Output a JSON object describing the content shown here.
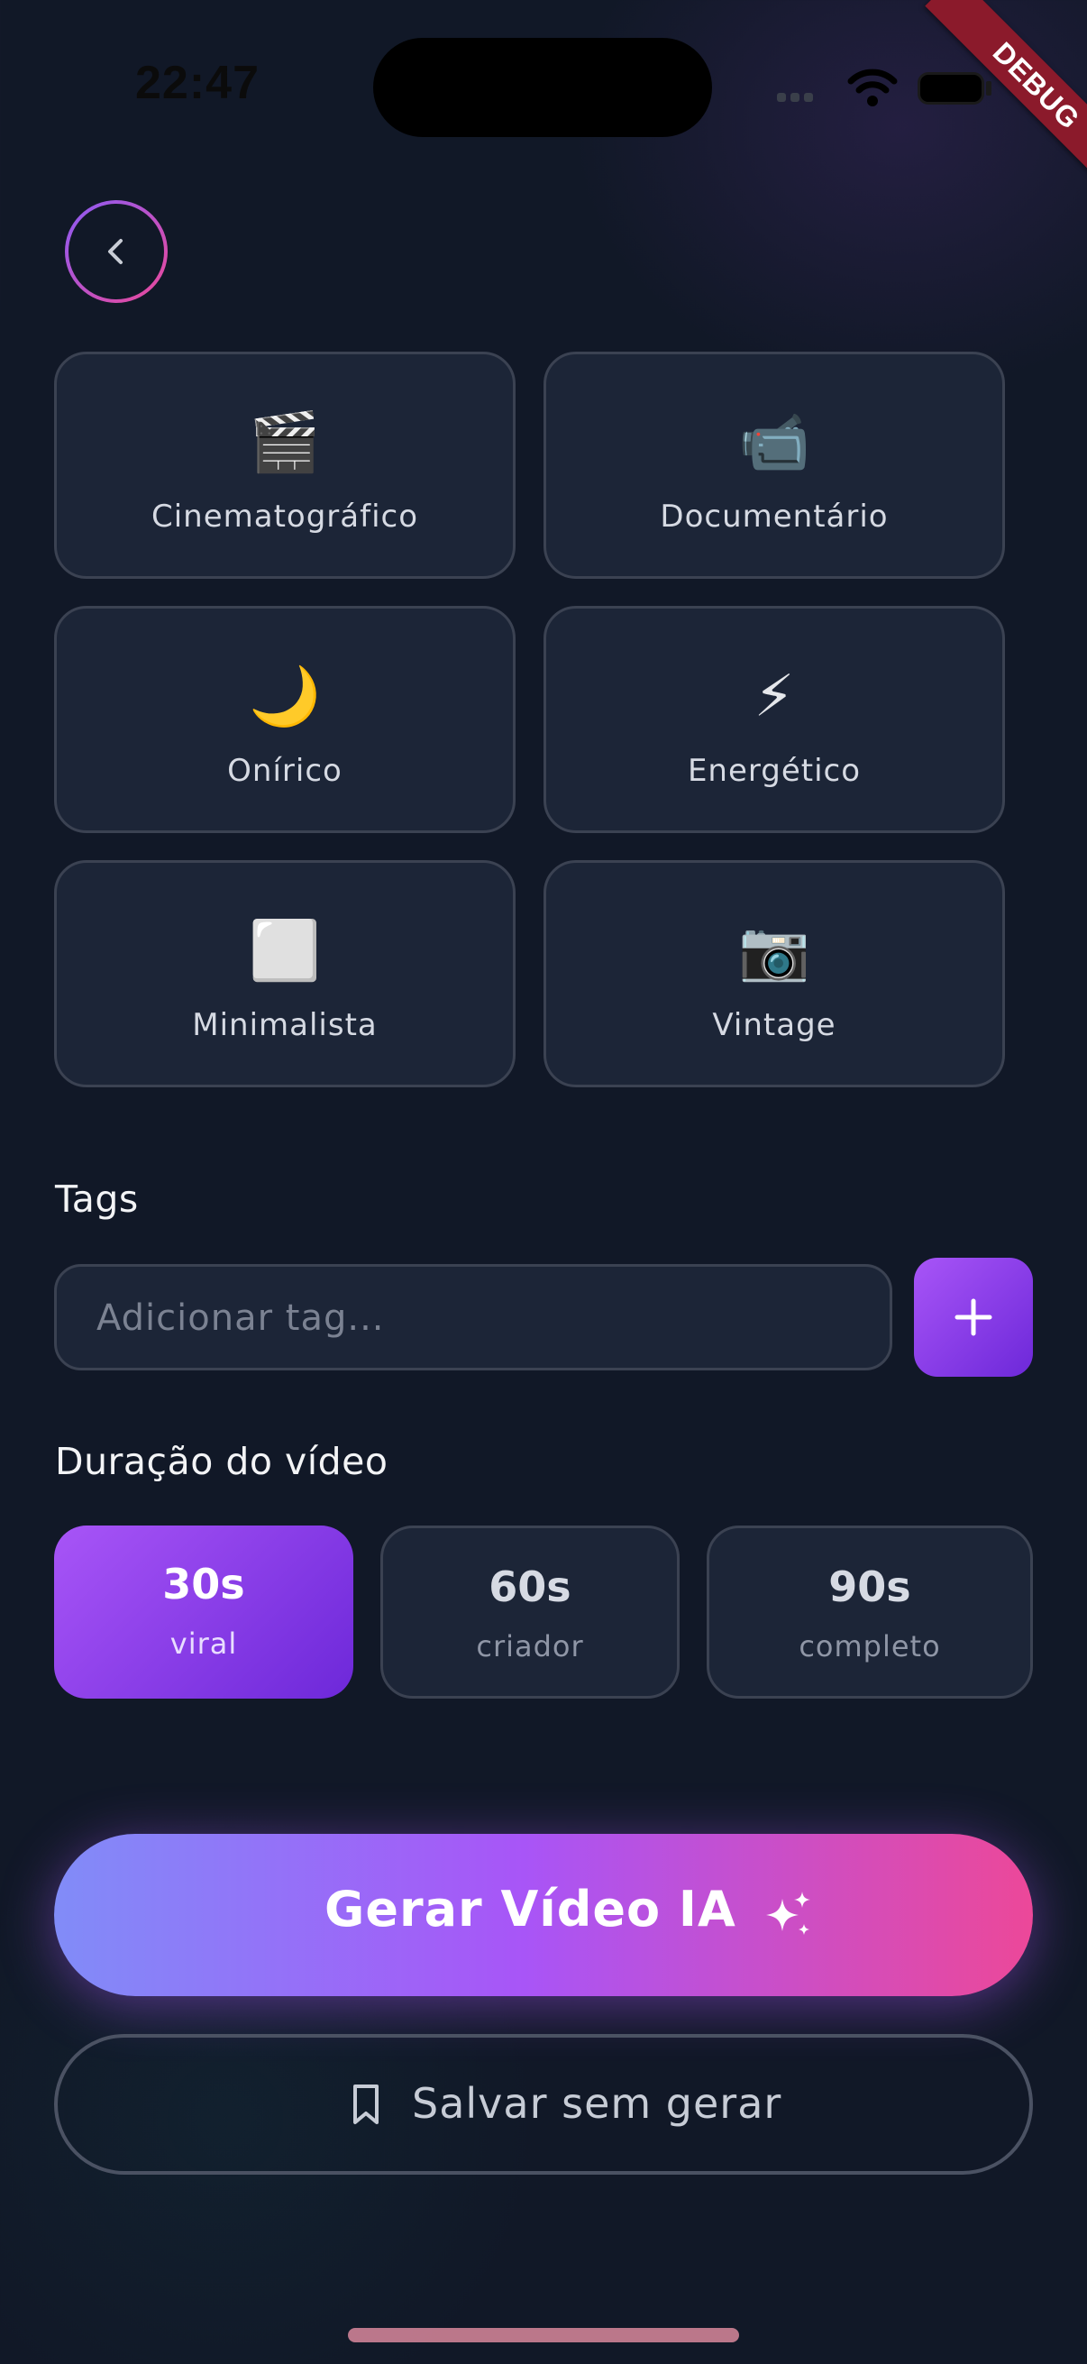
{
  "status_bar": {
    "time": "22:47"
  },
  "debug_banner": "DEBUG",
  "styles": [
    {
      "emoji": "🎬",
      "label": "Cinematográfico"
    },
    {
      "emoji": "📹",
      "label": "Documentário"
    },
    {
      "emoji": "🌙",
      "label": "Onírico"
    },
    {
      "emoji": "⚡",
      "label": "Energético"
    },
    {
      "emoji": "⬜",
      "label": "Minimalista"
    },
    {
      "emoji": "📷",
      "label": "Vintage"
    }
  ],
  "tags": {
    "title": "Tags",
    "placeholder": "Adicionar tag..."
  },
  "duration": {
    "title": "Duração do vídeo",
    "options": [
      {
        "value": "30s",
        "sub": "viral",
        "selected": true
      },
      {
        "value": "60s",
        "sub": "criador",
        "selected": false
      },
      {
        "value": "90s",
        "sub": "completo",
        "selected": false
      }
    ]
  },
  "actions": {
    "generate": "Gerar Vídeo IA",
    "save": "Salvar sem gerar"
  },
  "colors": {
    "background": "#111827",
    "card": "#1c2537",
    "accent_start": "#a855f7",
    "accent_end": "#6d28d9",
    "gradient_pink": "#ec4899",
    "gradient_indigo": "#818cf8"
  }
}
